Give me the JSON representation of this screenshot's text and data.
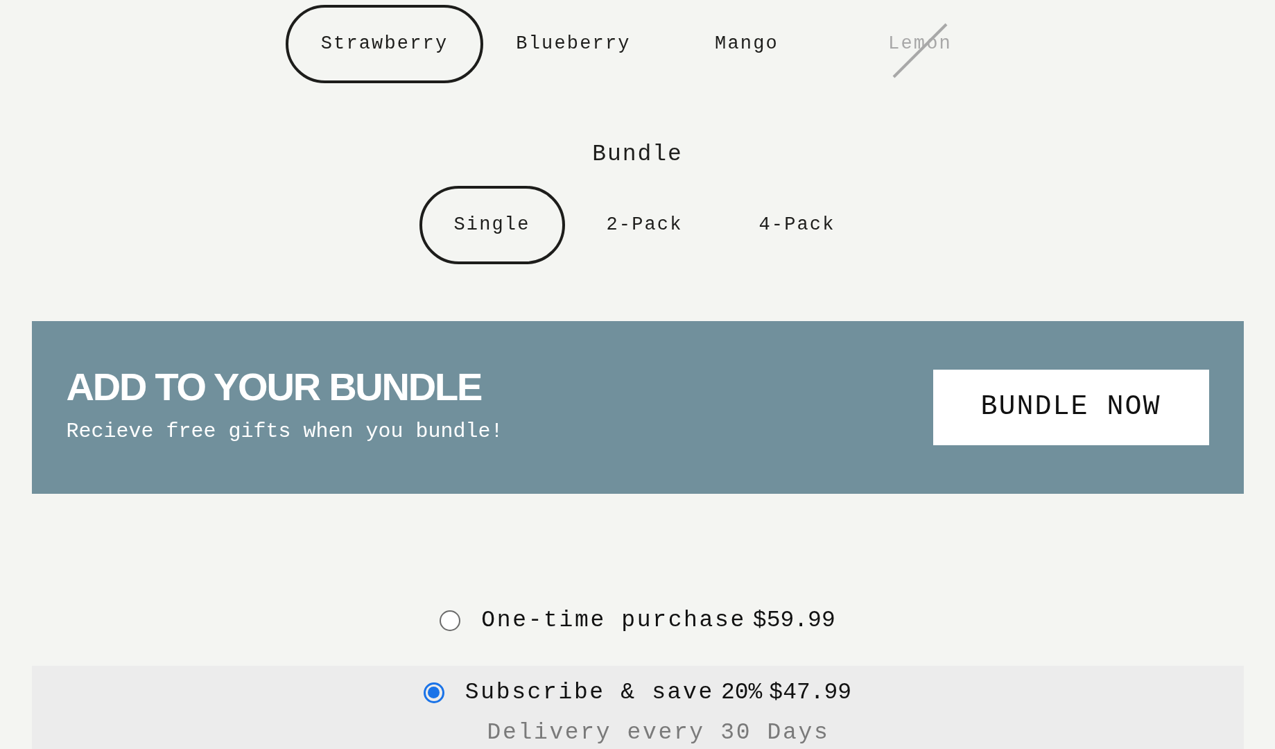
{
  "flavors": [
    {
      "label": "Strawberry",
      "selected": true,
      "available": true
    },
    {
      "label": "Blueberry",
      "selected": false,
      "available": true
    },
    {
      "label": "Mango",
      "selected": false,
      "available": true
    },
    {
      "label": "Lemon",
      "selected": false,
      "available": false
    }
  ],
  "bundle": {
    "title": "Bundle",
    "options": [
      {
        "label": "Single",
        "selected": true
      },
      {
        "label": "2-Pack",
        "selected": false
      },
      {
        "label": "4-Pack",
        "selected": false
      }
    ]
  },
  "banner": {
    "title": "ADD TO YOUR BUNDLE",
    "subtitle": "Recieve free gifts when you bundle!",
    "button": "BUNDLE NOW"
  },
  "purchase_options": [
    {
      "label": "One-time purchase",
      "price": "$59.99",
      "selected": false
    },
    {
      "label": "Subscribe & save",
      "discount": "20%",
      "price": "$47.99",
      "selected": true,
      "note": "Delivery every 30 Days"
    }
  ]
}
